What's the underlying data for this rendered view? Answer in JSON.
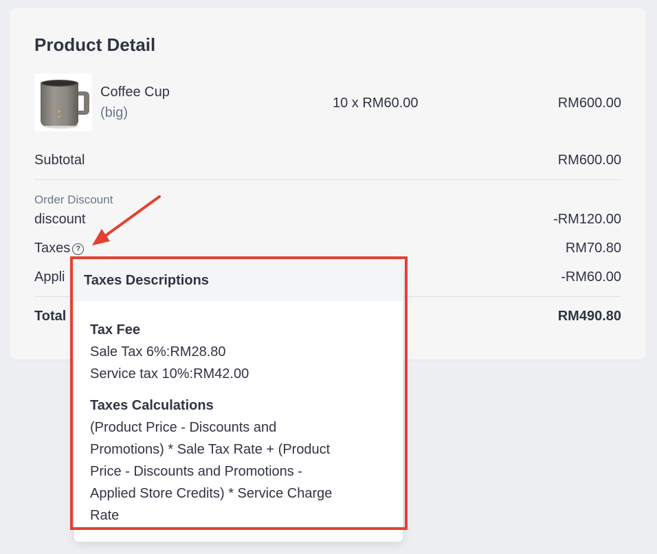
{
  "card": {
    "title": "Product Detail"
  },
  "product": {
    "image_icon": "coffee-mug-image",
    "name": "Coffee Cup",
    "variant": "(big)",
    "quantity_price": "10 x RM60.00",
    "line_total": "RM600.00"
  },
  "summary": {
    "subtotal_label": "Subtotal",
    "subtotal_value": "RM600.00",
    "order_discount_label": "Order Discount",
    "discount_label": "discount",
    "discount_value": "-RM120.00",
    "taxes_label": "Taxes",
    "taxes_help_icon": "question-circle-icon",
    "taxes_value": "RM70.80",
    "applied_label": "Appli",
    "applied_value": "-RM60.00",
    "total_label": "Total",
    "total_value": "RM490.80"
  },
  "popover": {
    "title": "Taxes Descriptions",
    "tax_fee_heading": "Tax Fee",
    "tax_fee_lines": [
      "Sale Tax 6%:RM28.80",
      "Service tax 10%:RM42.00"
    ],
    "calc_heading": "Taxes Calculations",
    "calc_lines": [
      "(Product Price - Discounts and",
      "Promotions) * Sale Tax Rate + (Product",
      "Price - Discounts and Promotions -",
      "Applied Store Credits) * Service Charge",
      "Rate"
    ]
  },
  "colors": {
    "page_bg": "#eceef1",
    "card_bg": "#f6f6f7",
    "text": "#2f3441",
    "muted": "#6b7689",
    "annotation": "#e5412f"
  }
}
